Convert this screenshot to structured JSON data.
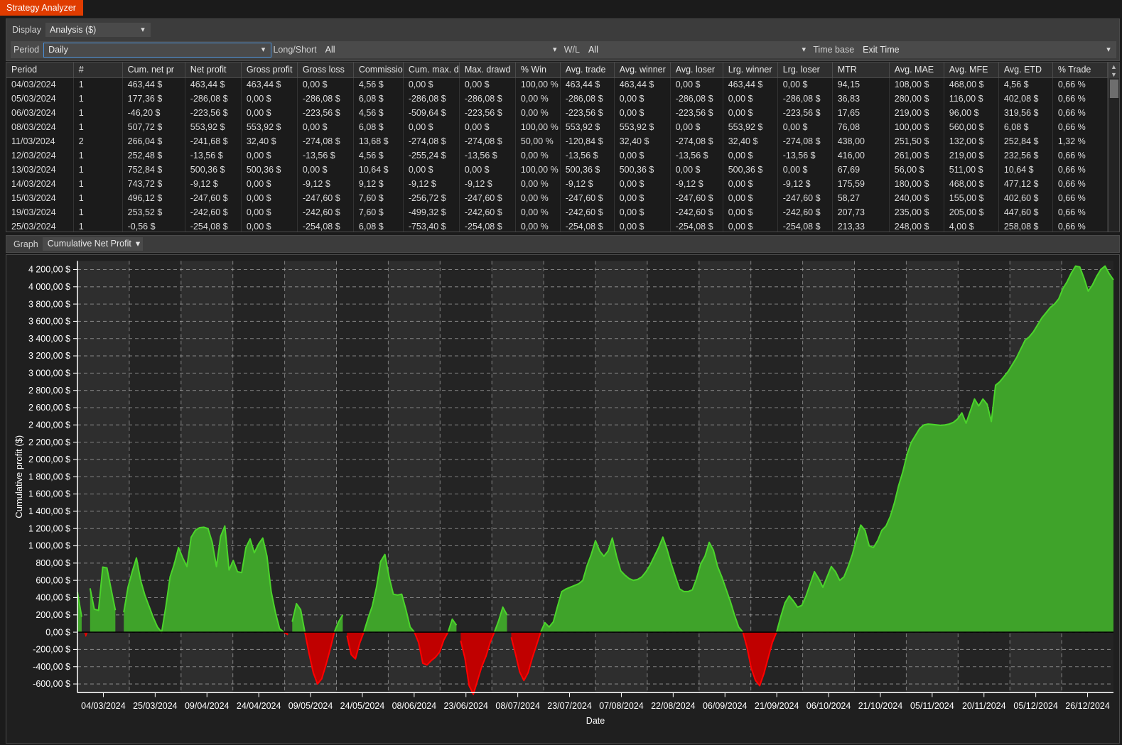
{
  "window": {
    "app_tab": "Strategy Analyzer"
  },
  "toolbar": {
    "display_label": "Display",
    "display_value": "Analysis ($)",
    "period_label": "Period",
    "period_value": "Daily",
    "longshort_label": "Long/Short",
    "longshort_value": "All",
    "wl_label": "W/L",
    "wl_value": "All",
    "timebase_label": "Time base",
    "timebase_value": "Exit Time",
    "chevron": "▾"
  },
  "graph_panel": {
    "label": "Graph",
    "selected": "Cumulative Net Profit",
    "chevron": "▾"
  },
  "table": {
    "columns": [
      "Period",
      "#",
      "Cum. net pr ",
      "Net profit",
      "Gross profit",
      "Gross loss",
      "Commission",
      "Cum. max. d",
      "Max. drawd ",
      "% Win",
      "Avg. trade",
      "Avg. winner",
      "Avg. loser",
      "Lrg. winner",
      "Lrg. loser",
      "MTR",
      "Avg. MAE",
      "Avg. MFE",
      "Avg. ETD",
      "% Trade"
    ],
    "rows": [
      {
        "cells": [
          "04/03/2024",
          "1",
          "463,44 $",
          "463,44 $",
          "463,44 $",
          "0,00 $",
          "4,56 $",
          "0,00 $",
          "0,00 $",
          "100,00 %",
          "463,44 $",
          "463,44 $",
          "0,00 $",
          "463,44 $",
          "0,00 $",
          "94,15",
          "108,00 $",
          "468,00 $",
          "4,56 $",
          "0,66 %"
        ],
        "neg": [
          false,
          false,
          false,
          false,
          false,
          false,
          false,
          false,
          false,
          false,
          false,
          false,
          false,
          false,
          false,
          false,
          false,
          false,
          false,
          false
        ]
      },
      {
        "cells": [
          "05/03/2024",
          "1",
          "177,36 $",
          "-286,08 $",
          "0,00 $",
          "-286,08 $",
          "6,08 $",
          "-286,08 $",
          "-286,08 $",
          "0,00 %",
          "-286,08 $",
          "0,00 $",
          "-286,08 $",
          "0,00 $",
          "-286,08 $",
          "36,83",
          "280,00 $",
          "116,00 $",
          "402,08 $",
          "0,66 %"
        ],
        "neg": [
          false,
          false,
          false,
          true,
          false,
          true,
          false,
          true,
          true,
          false,
          true,
          false,
          true,
          false,
          true,
          false,
          false,
          false,
          false,
          false
        ]
      },
      {
        "cells": [
          "06/03/2024",
          "1",
          "-46,20 $",
          "-223,56 $",
          "0,00 $",
          "-223,56 $",
          "4,56 $",
          "-509,64 $",
          "-223,56 $",
          "0,00 %",
          "-223,56 $",
          "0,00 $",
          "-223,56 $",
          "0,00 $",
          "-223,56 $",
          "17,65",
          "219,00 $",
          "96,00 $",
          "319,56 $",
          "0,66 %"
        ],
        "neg": [
          false,
          false,
          true,
          true,
          false,
          true,
          false,
          true,
          true,
          false,
          true,
          false,
          true,
          false,
          true,
          false,
          false,
          false,
          false,
          false
        ]
      },
      {
        "cells": [
          "08/03/2024",
          "1",
          "507,72 $",
          "553,92 $",
          "553,92 $",
          "0,00 $",
          "6,08 $",
          "0,00 $",
          "0,00 $",
          "100,00 %",
          "553,92 $",
          "553,92 $",
          "0,00 $",
          "553,92 $",
          "0,00 $",
          "76,08",
          "100,00 $",
          "560,00 $",
          "6,08 $",
          "0,66 %"
        ],
        "neg": [
          false,
          false,
          false,
          false,
          false,
          false,
          false,
          false,
          false,
          false,
          false,
          false,
          false,
          false,
          false,
          false,
          false,
          false,
          false,
          false
        ]
      },
      {
        "cells": [
          "11/03/2024",
          "2",
          "266,04 $",
          "-241,68 $",
          "32,40 $",
          "-274,08 $",
          "13,68 $",
          "-274,08 $",
          "-274,08 $",
          "50,00 %",
          "-120,84 $",
          "32,40 $",
          "-274,08 $",
          "32,40 $",
          "-274,08 $",
          "438,00",
          "251,50 $",
          "132,00 $",
          "252,84 $",
          "1,32 %"
        ],
        "neg": [
          false,
          false,
          false,
          true,
          false,
          true,
          false,
          true,
          true,
          false,
          true,
          false,
          true,
          false,
          true,
          false,
          false,
          false,
          false,
          false
        ]
      },
      {
        "cells": [
          "12/03/2024",
          "1",
          "252,48 $",
          "-13,56 $",
          "0,00 $",
          "-13,56 $",
          "4,56 $",
          "-255,24 $",
          "-13,56 $",
          "0,00 %",
          "-13,56 $",
          "0,00 $",
          "-13,56 $",
          "0,00 $",
          "-13,56 $",
          "416,00",
          "261,00 $",
          "219,00 $",
          "232,56 $",
          "0,66 %"
        ],
        "neg": [
          false,
          false,
          false,
          true,
          false,
          true,
          false,
          true,
          true,
          false,
          true,
          false,
          true,
          false,
          true,
          false,
          false,
          false,
          false,
          false
        ]
      },
      {
        "cells": [
          "13/03/2024",
          "1",
          "752,84 $",
          "500,36 $",
          "500,36 $",
          "0,00 $",
          "10,64 $",
          "0,00 $",
          "0,00 $",
          "100,00 %",
          "500,36 $",
          "500,36 $",
          "0,00 $",
          "500,36 $",
          "0,00 $",
          "67,69",
          "56,00 $",
          "511,00 $",
          "10,64 $",
          "0,66 %"
        ],
        "neg": [
          false,
          false,
          false,
          false,
          false,
          false,
          false,
          false,
          false,
          false,
          false,
          false,
          false,
          false,
          false,
          false,
          false,
          false,
          false,
          false
        ]
      },
      {
        "cells": [
          "14/03/2024",
          "1",
          "743,72 $",
          "-9,12 $",
          "0,00 $",
          "-9,12 $",
          "9,12 $",
          "-9,12 $",
          "-9,12 $",
          "0,00 %",
          "-9,12 $",
          "0,00 $",
          "-9,12 $",
          "0,00 $",
          "-9,12 $",
          "175,59",
          "180,00 $",
          "468,00 $",
          "477,12 $",
          "0,66 %"
        ],
        "neg": [
          false,
          false,
          false,
          true,
          false,
          true,
          false,
          true,
          true,
          false,
          true,
          false,
          true,
          false,
          true,
          false,
          false,
          false,
          false,
          false
        ]
      },
      {
        "cells": [
          "15/03/2024",
          "1",
          "496,12 $",
          "-247,60 $",
          "0,00 $",
          "-247,60 $",
          "7,60 $",
          "-256,72 $",
          "-247,60 $",
          "0,00 %",
          "-247,60 $",
          "0,00 $",
          "-247,60 $",
          "0,00 $",
          "-247,60 $",
          "58,27",
          "240,00 $",
          "155,00 $",
          "402,60 $",
          "0,66 %"
        ],
        "neg": [
          false,
          false,
          false,
          true,
          false,
          true,
          false,
          true,
          true,
          false,
          true,
          false,
          true,
          false,
          true,
          false,
          false,
          false,
          false,
          false
        ]
      },
      {
        "cells": [
          "19/03/2024",
          "1",
          "253,52 $",
          "-242,60 $",
          "0,00 $",
          "-242,60 $",
          "7,60 $",
          "-499,32 $",
          "-242,60 $",
          "0,00 %",
          "-242,60 $",
          "0,00 $",
          "-242,60 $",
          "0,00 $",
          "-242,60 $",
          "207,73",
          "235,00 $",
          "205,00 $",
          "447,60 $",
          "0,66 %"
        ],
        "neg": [
          false,
          false,
          false,
          true,
          false,
          true,
          false,
          true,
          true,
          false,
          true,
          false,
          true,
          false,
          true,
          false,
          false,
          false,
          false,
          false
        ]
      },
      {
        "cells": [
          "25/03/2024",
          "1",
          "-0,56 $",
          "-254,08 $",
          "0,00 $",
          "-254,08 $",
          "6,08 $",
          "-753,40 $",
          "-254,08 $",
          "0,00 %",
          "-254,08 $",
          "0,00 $",
          "-254,08 $",
          "0,00 $",
          "-254,08 $",
          "213,33",
          "248,00 $",
          "4,00 $",
          "258,08 $",
          "0,66 %"
        ],
        "neg": [
          false,
          false,
          true,
          true,
          false,
          true,
          false,
          true,
          true,
          false,
          true,
          false,
          true,
          false,
          true,
          false,
          false,
          false,
          false,
          false
        ]
      }
    ]
  },
  "chart_data": {
    "type": "area",
    "title": "",
    "xlabel": "Date",
    "ylabel": "Cumulative profit ($)",
    "ylim": [
      -700,
      4300
    ],
    "yticks": [
      4200,
      4000,
      3800,
      3600,
      3400,
      3200,
      3000,
      2800,
      2600,
      2400,
      2200,
      2000,
      1800,
      1600,
      1400,
      1200,
      1000,
      800,
      600,
      400,
      200,
      0,
      -200,
      -400,
      -600
    ],
    "ytick_labels": [
      "4 200,00 $",
      "4 000,00 $",
      "3 800,00 $",
      "3 600,00 $",
      "3 400,00 $",
      "3 200,00 $",
      "3 000,00 $",
      "2 800,00 $",
      "2 600,00 $",
      "2 400,00 $",
      "2 200,00 $",
      "2 000,00 $",
      "1 800,00 $",
      "1 600,00 $",
      "1 400,00 $",
      "1 200,00 $",
      "1 000,00 $",
      "800,00 $",
      "600,00 $",
      "400,00 $",
      "200,00 $",
      "0,00 $",
      "-200,00 $",
      "-400,00 $",
      "-600,00 $"
    ],
    "xtick_labels": [
      "04/03/2024",
      "25/03/2024",
      "09/04/2024",
      "24/04/2024",
      "09/05/2024",
      "24/05/2024",
      "08/06/2024",
      "23/06/2024",
      "08/07/2024",
      "23/07/2024",
      "07/08/2024",
      "22/08/2024",
      "06/09/2024",
      "21/09/2024",
      "06/10/2024",
      "21/10/2024",
      "05/11/2024",
      "20/11/2024",
      "05/12/2024",
      "26/12/2024"
    ],
    "grid": true,
    "legend": "none",
    "colors": {
      "positive": "#3fa32a",
      "positive_line": "#4bd42b",
      "negative": "#c00000",
      "negative_line": "#ff0000",
      "background": "#242424",
      "band": "#2e2e2e",
      "gridline": "#c8c8c8"
    },
    "series_name": "Cumulative Net Profit",
    "values": [
      463,
      177,
      -46,
      508,
      266,
      252,
      753,
      744,
      496,
      254,
      -1,
      230,
      520,
      700,
      860,
      600,
      430,
      300,
      170,
      60,
      0,
      300,
      640,
      790,
      980,
      860,
      760,
      1100,
      1180,
      1210,
      1215,
      1200,
      1040,
      760,
      1110,
      1230,
      720,
      830,
      700,
      690,
      980,
      1080,
      920,
      1020,
      1090,
      880,
      470,
      230,
      40,
      0,
      -30,
      120,
      330,
      260,
      0,
      -250,
      -470,
      -600,
      -540,
      -380,
      -200,
      0,
      120,
      200,
      -40,
      -260,
      -310,
      -130,
      0,
      160,
      300,
      520,
      820,
      900,
      640,
      440,
      430,
      440,
      260,
      60,
      0,
      -120,
      -360,
      -380,
      -330,
      -290,
      -230,
      -90,
      0,
      150,
      80,
      -100,
      -300,
      -620,
      -720,
      -560,
      -400,
      -280,
      -120,
      0,
      130,
      290,
      200,
      -60,
      -250,
      -460,
      -560,
      -470,
      -300,
      -150,
      0,
      110,
      60,
      120,
      300,
      470,
      500,
      520,
      540,
      560,
      600,
      770,
      900,
      1060,
      940,
      880,
      940,
      1090,
      880,
      710,
      660,
      620,
      600,
      610,
      640,
      700,
      780,
      880,
      980,
      1100,
      960,
      790,
      640,
      500,
      470,
      470,
      490,
      620,
      790,
      880,
      1040,
      950,
      760,
      640,
      500,
      360,
      200,
      60,
      0,
      -180,
      -420,
      -560,
      -620,
      -480,
      -300,
      -120,
      0,
      180,
      340,
      420,
      360,
      290,
      310,
      420,
      560,
      700,
      620,
      520,
      640,
      760,
      700,
      600,
      640,
      760,
      900,
      1080,
      1240,
      1180,
      1000,
      980,
      1060,
      1180,
      1230,
      1340,
      1500,
      1700,
      1860,
      2060,
      2200,
      2280,
      2360,
      2400,
      2410,
      2405,
      2400,
      2395,
      2400,
      2410,
      2430,
      2470,
      2540,
      2420,
      2560,
      2700,
      2620,
      2700,
      2640,
      2440,
      2860,
      2900,
      2960,
      3020,
      3100,
      3180,
      3280,
      3380,
      3420,
      3480,
      3560,
      3640,
      3700,
      3760,
      3800,
      3860,
      3980,
      4060,
      4160,
      4240,
      4230,
      4100,
      3950,
      4020,
      4120,
      4200,
      4240,
      4150,
      4080
    ]
  }
}
